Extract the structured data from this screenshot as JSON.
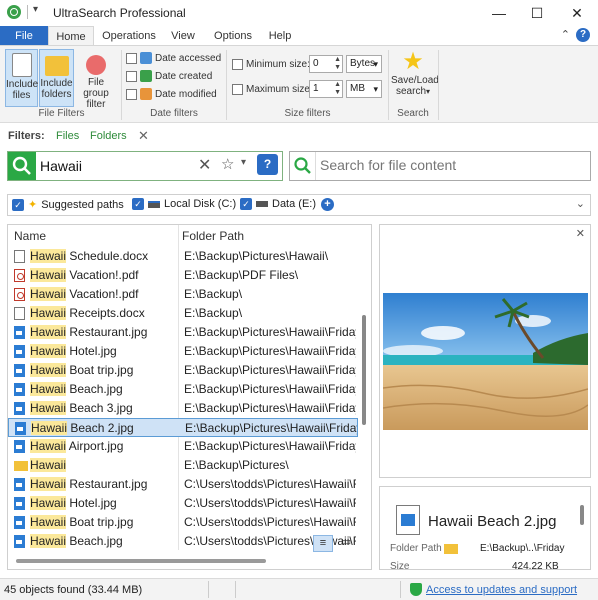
{
  "window": {
    "title": "UltraSearch Professional",
    "minimize": "—",
    "maximize": "☐",
    "close": "✕"
  },
  "ribbon_tabs": [
    "File",
    "Home",
    "Operations",
    "View",
    "Options",
    "Help"
  ],
  "ribbon": {
    "include_files": "Include files",
    "include_folders": "Include folders",
    "file_group_filter": "File group filter",
    "file_filters_label": "File Filters",
    "date_accessed": "Date accessed",
    "date_created": "Date created",
    "date_modified": "Date modified",
    "date_filters_label": "Date filters",
    "minimum_size": "Minimum size:",
    "min_value": "0",
    "min_unit": "Bytes",
    "maximum_size": "Maximum size:",
    "max_value": "1",
    "max_unit": "MB",
    "size_filters_label": "Size filters",
    "save_load_search": "Save/Load search",
    "search_label": "Search"
  },
  "filters": {
    "label": "Filters:",
    "chips": [
      "Files",
      "Folders"
    ]
  },
  "search": {
    "query": "Hawaii",
    "content_placeholder": "Search for file content"
  },
  "drives": {
    "items": [
      "Suggested paths",
      "Local Disk (C:)",
      "Data (E:)"
    ]
  },
  "results": {
    "columns": [
      "Name",
      "Folder Path"
    ],
    "rows": [
      {
        "highlight": "Hawaii",
        "rest": " Schedule.docx",
        "path": "E:\\Backup\\Pictures\\Hawaii\\",
        "type": "docx"
      },
      {
        "highlight": "Hawaii",
        "rest": " Vacation!.pdf",
        "path": "E:\\Backup\\PDF Files\\",
        "type": "pdf"
      },
      {
        "highlight": "Hawaii",
        "rest": " Vacation!.pdf",
        "path": "E:\\Backup\\",
        "type": "pdf"
      },
      {
        "highlight": "Hawaii",
        "rest": " Receipts.docx",
        "path": "E:\\Backup\\",
        "type": "docx"
      },
      {
        "highlight": "Hawaii",
        "rest": " Restaurant.jpg",
        "path": "E:\\Backup\\Pictures\\Hawaii\\Friday\\",
        "type": "jpg"
      },
      {
        "highlight": "Hawaii",
        "rest": " Hotel.jpg",
        "path": "E:\\Backup\\Pictures\\Hawaii\\Friday\\",
        "type": "jpg"
      },
      {
        "highlight": "Hawaii",
        "rest": " Boat trip.jpg",
        "path": "E:\\Backup\\Pictures\\Hawaii\\Friday\\",
        "type": "jpg"
      },
      {
        "highlight": "Hawaii",
        "rest": " Beach.jpg",
        "path": "E:\\Backup\\Pictures\\Hawaii\\Friday\\",
        "type": "jpg"
      },
      {
        "highlight": "Hawaii",
        "rest": " Beach 3.jpg",
        "path": "E:\\Backup\\Pictures\\Hawaii\\Friday\\",
        "type": "jpg"
      },
      {
        "highlight": "Hawaii",
        "rest": " Beach 2.jpg",
        "path": "E:\\Backup\\Pictures\\Hawaii\\Friday\\",
        "type": "jpg",
        "selected": true
      },
      {
        "highlight": "Hawaii",
        "rest": " Airport.jpg",
        "path": "E:\\Backup\\Pictures\\Hawaii\\Friday\\",
        "type": "jpg"
      },
      {
        "highlight": "Hawaii",
        "rest": "",
        "path": "E:\\Backup\\Pictures\\",
        "type": "folder"
      },
      {
        "highlight": "Hawaii",
        "rest": " Restaurant.jpg",
        "path": "C:\\Users\\todds\\Pictures\\Hawaii\\Friday\\",
        "type": "jpg"
      },
      {
        "highlight": "Hawaii",
        "rest": " Hotel.jpg",
        "path": "C:\\Users\\todds\\Pictures\\Hawaii\\Friday\\",
        "type": "jpg"
      },
      {
        "highlight": "Hawaii",
        "rest": " Boat trip.jpg",
        "path": "C:\\Users\\todds\\Pictures\\Hawaii\\Friday\\",
        "type": "jpg"
      },
      {
        "highlight": "Hawaii",
        "rest": " Beach.jpg",
        "path": "C:\\Users\\todds\\Pictures\\Hawaii\\Friday\\",
        "type": "jpg"
      }
    ]
  },
  "preview": {
    "file_name": "Hawaii Beach 2.jpg",
    "folder_path_label": "Folder Path",
    "folder_path": "E:\\Backup\\..\\Friday",
    "size_label": "Size",
    "size": "424.22 KB"
  },
  "status": {
    "text": "45 objects found (33.44 MB)",
    "link": "Access to updates and support"
  },
  "colors": {
    "accent": "#2b6cc4",
    "green": "#2aa845",
    "highlight": "#fbe89a",
    "selection": "#cfe2f6"
  }
}
